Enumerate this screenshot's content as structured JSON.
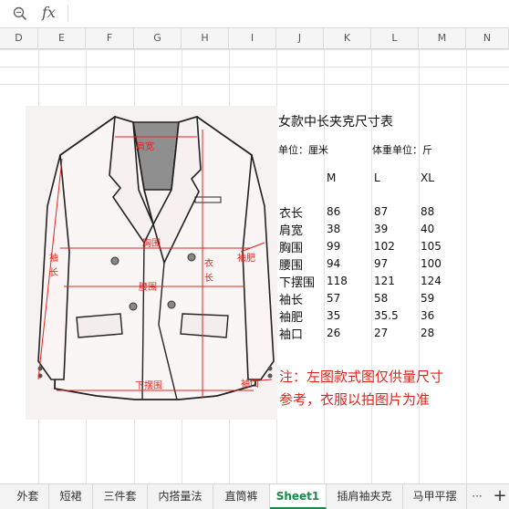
{
  "formula_bar": {
    "fx_label": "fx",
    "cell_value": ""
  },
  "columns": [
    "D",
    "E",
    "F",
    "G",
    "H",
    "I",
    "J",
    "K",
    "L",
    "M",
    "N"
  ],
  "sheet": {
    "title": "女款中长夹克尺寸表",
    "unit_left": "单位：厘米",
    "unit_right": "体重单位：斤",
    "size_headers": [
      "M",
      "L",
      "XL"
    ],
    "rows": [
      {
        "label": "衣长",
        "values": [
          "86",
          "87",
          "88"
        ]
      },
      {
        "label": "肩宽",
        "values": [
          "38",
          "39",
          "40"
        ]
      },
      {
        "label": "胸围",
        "values": [
          "99",
          "102",
          "105"
        ]
      },
      {
        "label": "腰围",
        "values": [
          "94",
          "97",
          "100"
        ]
      },
      {
        "label": "下摆围",
        "values": [
          "118",
          "121",
          "124"
        ]
      },
      {
        "label": "袖长",
        "values": [
          "57",
          "58",
          "59"
        ]
      },
      {
        "label": "袖肥",
        "values": [
          "35",
          "35.5",
          "36"
        ]
      },
      {
        "label": "袖口",
        "values": [
          "26",
          "27",
          "28"
        ]
      }
    ],
    "note_line1": "注：左图款式图仅供量尺寸",
    "note_line2": "参考，衣服以拍图片为准"
  },
  "jacket_labels": {
    "shoulder": "肩宽",
    "chest": "胸围",
    "waist": "腰围",
    "hem": "下摆围",
    "sleeve_length_1": "袖",
    "sleeve_length_2": "长",
    "body_length_1": "衣",
    "body_length_2": "长",
    "sleeve_width": "袖肥",
    "cuff": "袖口"
  },
  "tabs": [
    "外套",
    "短裙",
    "三件套",
    "内搭量法",
    "直筒裤",
    "Sheet1",
    "插肩袖夹克",
    "马甲平摆"
  ],
  "active_tab": "Sheet1",
  "tab_more_label": "···",
  "tab_add_label": "+",
  "colors": {
    "accent": "#1a8a4a",
    "measure_red": "#e0241c"
  }
}
